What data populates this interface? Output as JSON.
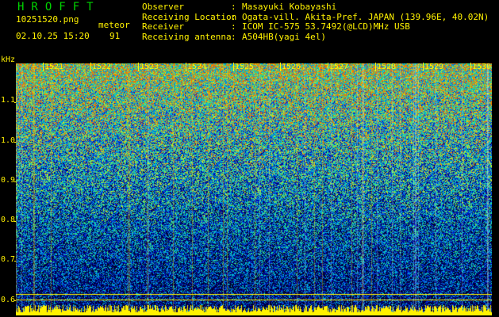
{
  "header": {
    "app_title": "HROFFT",
    "file_name": "10251520.png",
    "mode": "meteor",
    "timestamp": "02.10.25 15:20",
    "count": "91"
  },
  "info": [
    {
      "key": "Observer",
      "sep": ":",
      "value": "Masayuki Kobayashi"
    },
    {
      "key": "Receiving Location",
      "sep": ":",
      "value": "Ogata-vill. Akita-Pref. JAPAN (139.96E, 40.02N)"
    },
    {
      "key": "Receiver",
      "sep": ":",
      "value": "ICOM IC-575 53.7492(@LCD)MHz USB"
    },
    {
      "key": "Receiving antenna",
      "sep": ":",
      "value": "A504HB(yagi 4el)"
    }
  ],
  "y_axis": {
    "unit": "kHz",
    "ticks": [
      "1.1",
      "1.0",
      "0.9",
      "0.8",
      "0.7",
      "0.6"
    ]
  },
  "x_axis": {
    "minutes": [
      "1521",
      "1522",
      "1523",
      "1524",
      "1525",
      "1526",
      "1527",
      "1528",
      "1529",
      "1530"
    ]
  },
  "colors": {
    "label": "#fff200",
    "title": "#00d400",
    "background": "#000000"
  }
}
